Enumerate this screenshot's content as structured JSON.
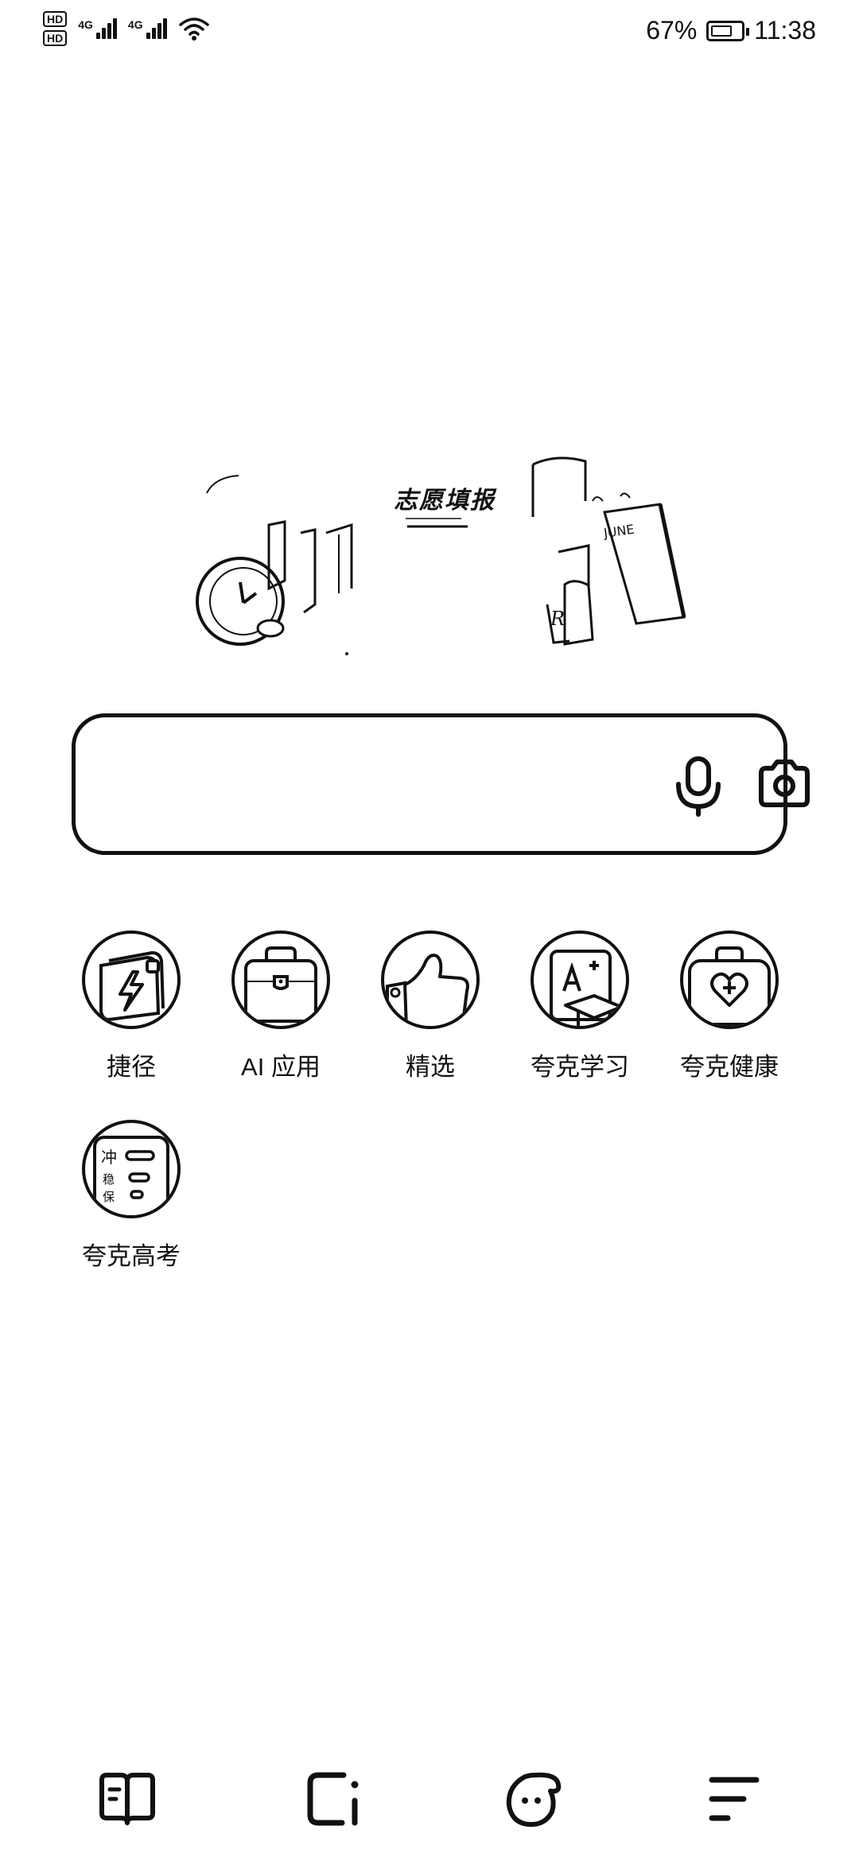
{
  "status_bar": {
    "hd_labels": [
      "HD",
      "HD"
    ],
    "network_1": "4G",
    "network_2": "4G",
    "battery_percent": "67%",
    "time": "11:38"
  },
  "banner": {
    "title": "志愿填报",
    "calendar_text": "JUNE",
    "cup_letter": "R"
  },
  "search": {
    "placeholder": "",
    "mic_icon": "microphone-icon",
    "camera_icon": "camera-icon"
  },
  "apps": [
    {
      "label": "捷径",
      "icon": "lightning-card-icon"
    },
    {
      "label": "AI 应用",
      "icon": "toolbox-icon"
    },
    {
      "label": "精选",
      "icon": "thumbs-up-icon"
    },
    {
      "label": "夸克学习",
      "icon": "graduation-board-icon"
    },
    {
      "label": "夸克健康",
      "icon": "medical-kit-heart-icon"
    },
    {
      "label": "夸克高考",
      "icon": "exam-card-icon",
      "card_text": [
        "冲",
        "稳",
        "保"
      ]
    }
  ],
  "bottom_nav": [
    {
      "icon": "book-icon"
    },
    {
      "icon": "tabs-icon"
    },
    {
      "icon": "quark-mascot-icon"
    },
    {
      "icon": "menu-icon"
    }
  ]
}
